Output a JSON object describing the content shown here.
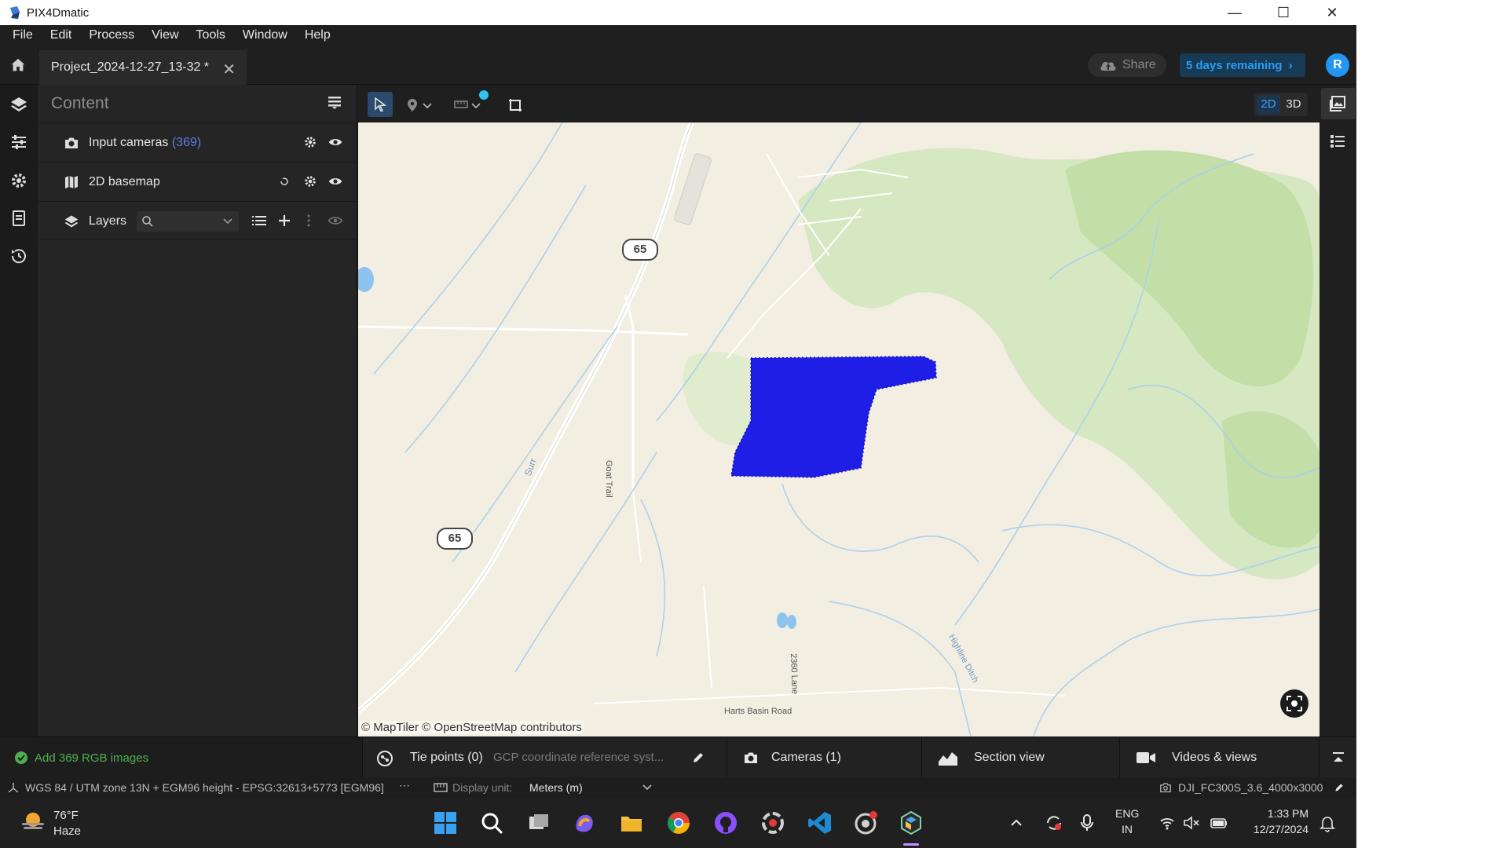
{
  "window": {
    "title": "PIX4Dmatic",
    "controls": [
      "minimize-icon",
      "maximize-icon",
      "close-icon"
    ]
  },
  "menu": [
    "File",
    "Edit",
    "Process",
    "View",
    "Tools",
    "Window",
    "Help"
  ],
  "tabbar": {
    "project_tab": "Project_2024-12-27_13-32 *",
    "share_label": "Share",
    "trial_label": "5 days remaining",
    "avatar_initial": "R"
  },
  "content_panel": {
    "title": "Content",
    "rows": [
      {
        "label": "Input cameras",
        "count": "(369)",
        "icon": "camera-icon"
      },
      {
        "label": "2D basemap",
        "icon": "map-icon"
      },
      {
        "label": "Layers",
        "icon": "layers-icon",
        "search_placeholder": ""
      }
    ]
  },
  "view_toggle": {
    "two_d": "2D",
    "three_d": "3D",
    "active": "2D"
  },
  "map": {
    "attribution": "© MapTiler  © OpenStreetMap contributors",
    "labels": {
      "route_shield_1": "65",
      "route_shield_2": "65",
      "goat_trail": "Goat Trail",
      "surr": "Surr",
      "lane_2360": "2360 Lane",
      "harts_basin": "Harts Basin Road",
      "highline_ditch": "Highline Ditch"
    },
    "camera_cluster_color": "#1e1ee6"
  },
  "bottom_bar": {
    "status": "Add 369 RGB images",
    "tie_points": "Tie points (0)",
    "gcp_text": "GCP coordinate reference syst...",
    "cameras": "Cameras (1)",
    "section_view": "Section view",
    "videos_views": "Videos & views"
  },
  "footer": {
    "crs": "WGS 84 / UTM zone 13N + EGM96 height - EPSG:32613+5773 [EGM96]",
    "display_unit_label": "Display unit:",
    "display_unit_value": "Meters (m)",
    "camera_model": "DJI_FC300S_3.6_4000x3000"
  },
  "taskbar": {
    "temperature": "76°F",
    "condition": "Haze",
    "lang_top": "ENG",
    "lang_bottom": "IN",
    "time": "1:33 PM",
    "date": "12/27/2024"
  },
  "colors": {
    "accent": "#2196f3",
    "trial_text": "#2a9df4",
    "status_ok": "#4caf50",
    "count": "#5b7ee5"
  }
}
